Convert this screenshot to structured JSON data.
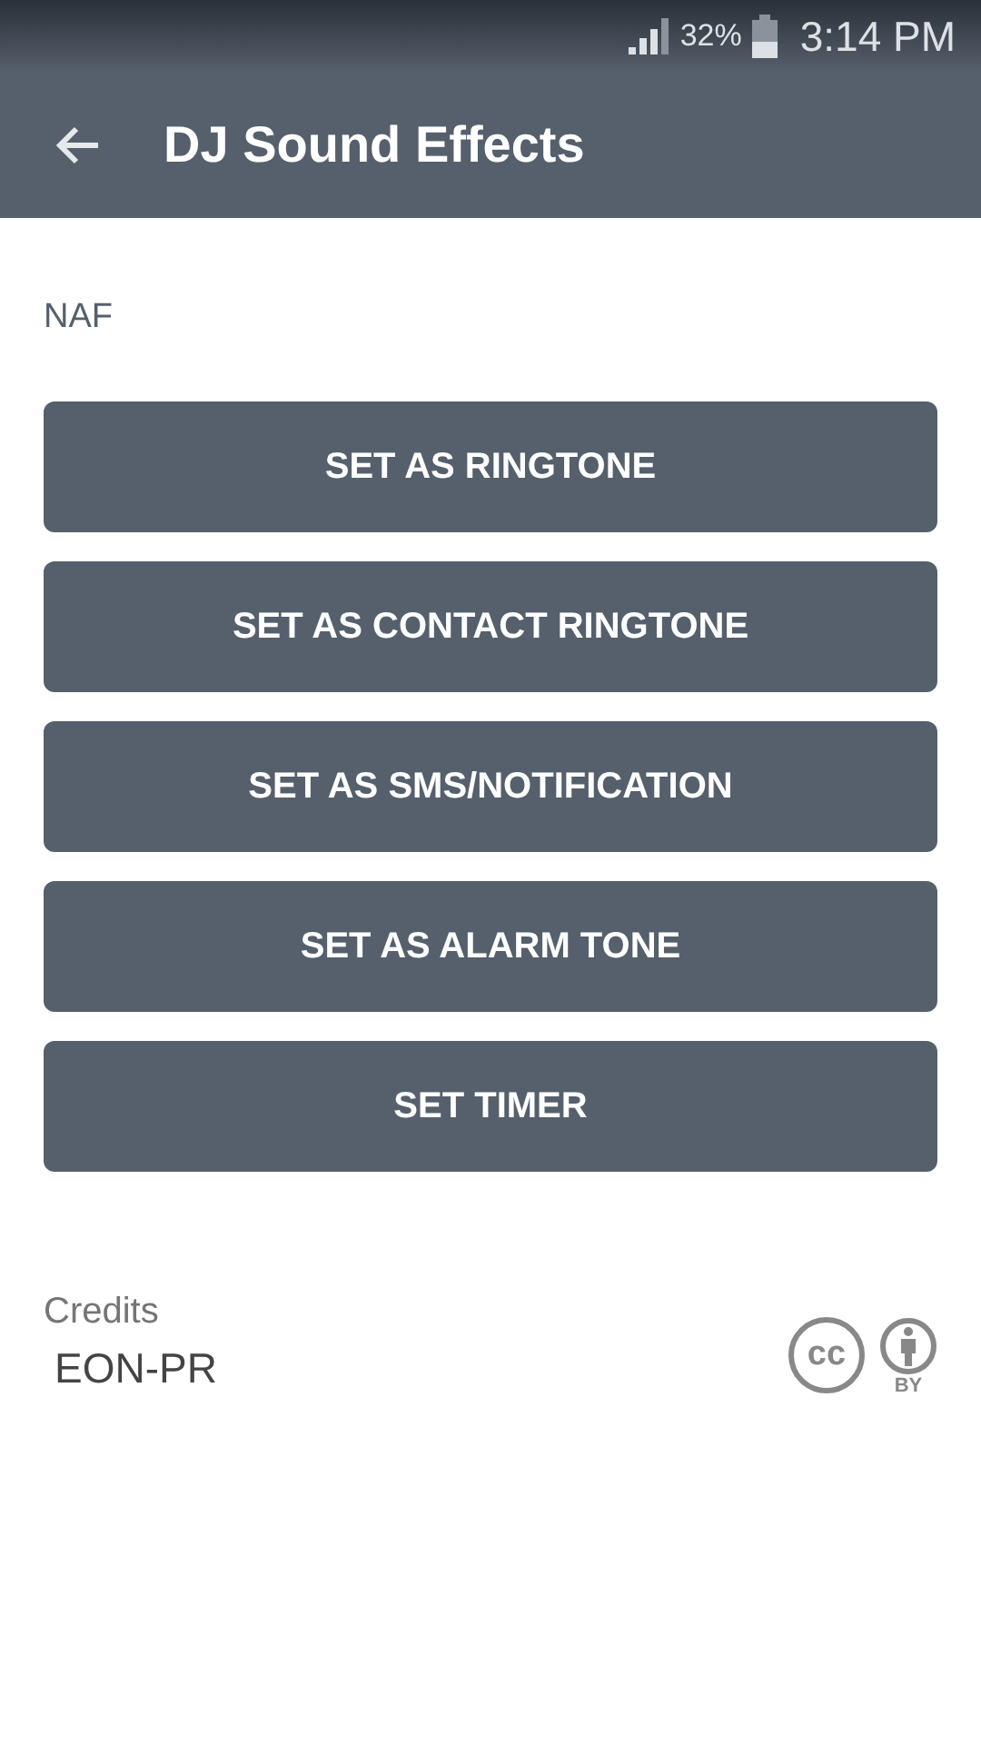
{
  "status_bar": {
    "battery": "32%",
    "time": "3:14 PM"
  },
  "app_bar": {
    "title": "DJ Sound Effects"
  },
  "sound_name": "NAF",
  "buttons": [
    "SET AS RINGTONE",
    "SET AS CONTACT RINGTONE",
    "SET AS SMS/NOTIFICATION",
    "SET AS ALARM TONE",
    "SET TIMER"
  ],
  "credits": {
    "label": "Credits",
    "author": "EON-PR",
    "license_marks": [
      "cc",
      "BY"
    ]
  }
}
